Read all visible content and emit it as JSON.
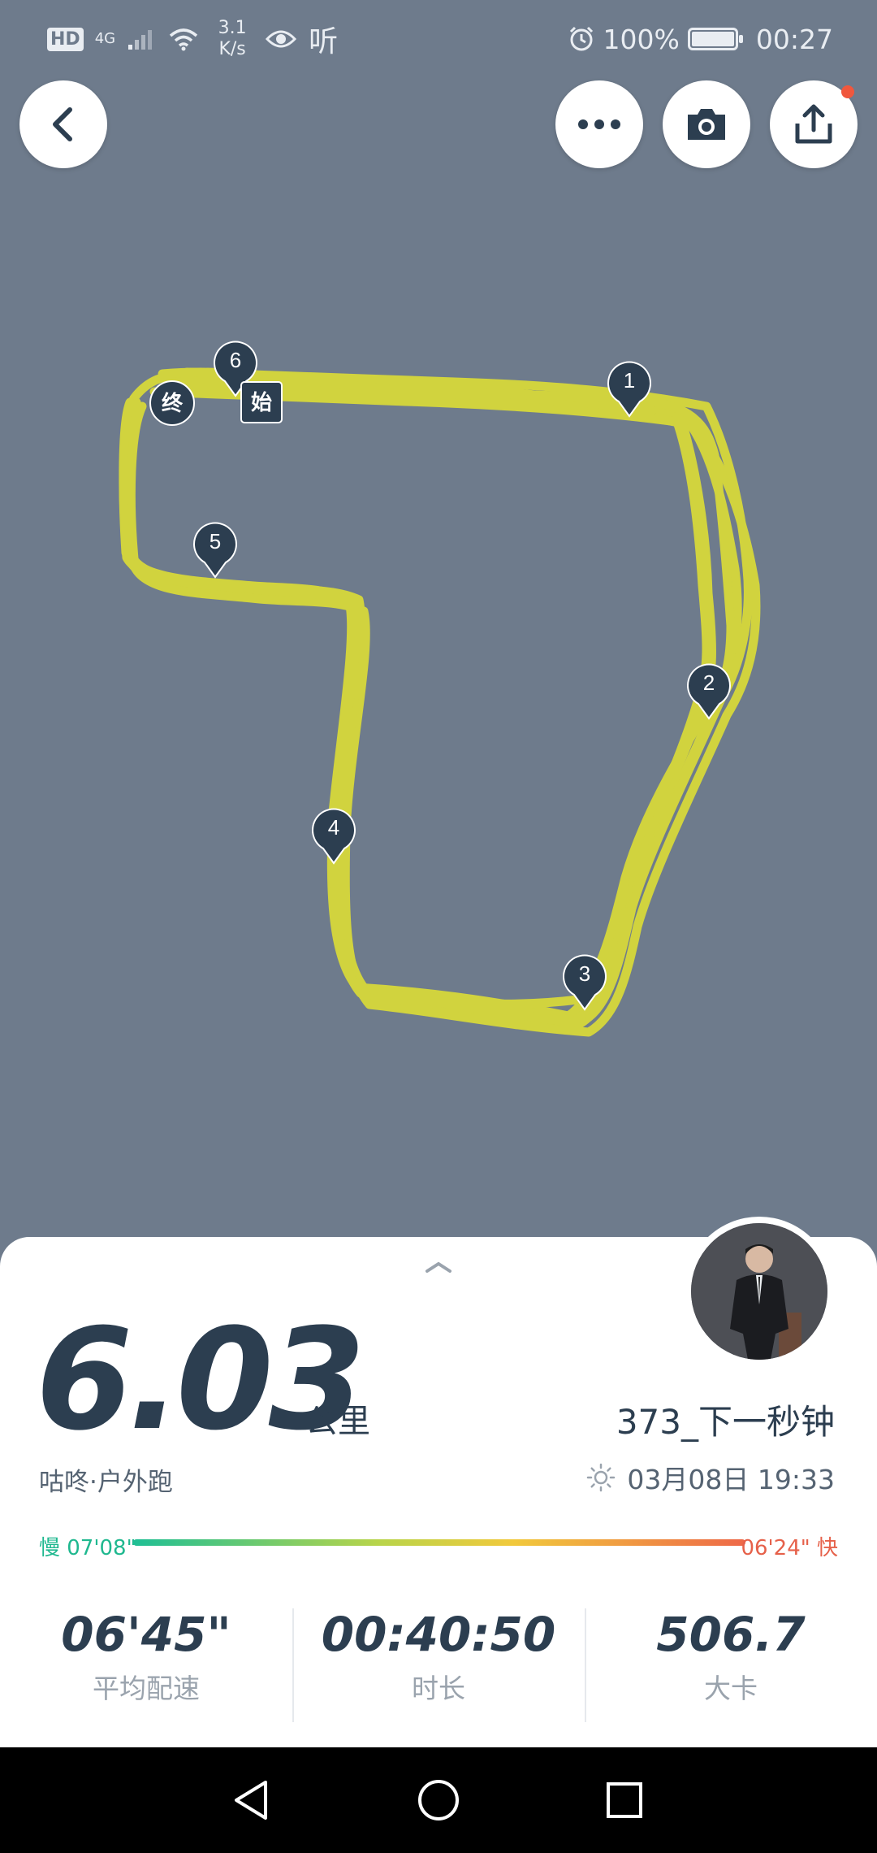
{
  "status_bar": {
    "hd": "HD",
    "network": "4G",
    "speed_value": "3.1",
    "speed_unit": "K/s",
    "ting": "听",
    "battery": "100%",
    "time": "00:27"
  },
  "top_buttons": {
    "back_icon": "chevron-left-icon",
    "more_icon": "more-dots-icon",
    "camera_icon": "camera-icon",
    "share_icon": "share-upload-icon"
  },
  "map": {
    "route_color": "#d7d83a",
    "background_color": "#6e7b8c",
    "markers": [
      {
        "label": "1"
      },
      {
        "label": "2"
      },
      {
        "label": "3"
      },
      {
        "label": "4"
      },
      {
        "label": "5"
      },
      {
        "label": "6"
      }
    ],
    "start_label": "始",
    "end_label": "终"
  },
  "summary": {
    "distance": "6.03",
    "distance_unit": "公里",
    "username": "373_下一秒钟",
    "sport_type": "咕咚·户外跑",
    "date": "03月08日 19:33",
    "weather_icon": "sun-icon",
    "pace_slow_label": "慢 07'08\"",
    "pace_fast_label": "06'24\" 快"
  },
  "stats": [
    {
      "value": "06'45\"",
      "label": "平均配速"
    },
    {
      "value": "00:40:50",
      "label": "时长"
    },
    {
      "value": "506.7",
      "label": "大卡"
    }
  ],
  "colors": {
    "accent_dark": "#2c3e50",
    "pace_slow": "#1fb88f",
    "pace_fast": "#e6614a",
    "notify": "#f0573d"
  }
}
